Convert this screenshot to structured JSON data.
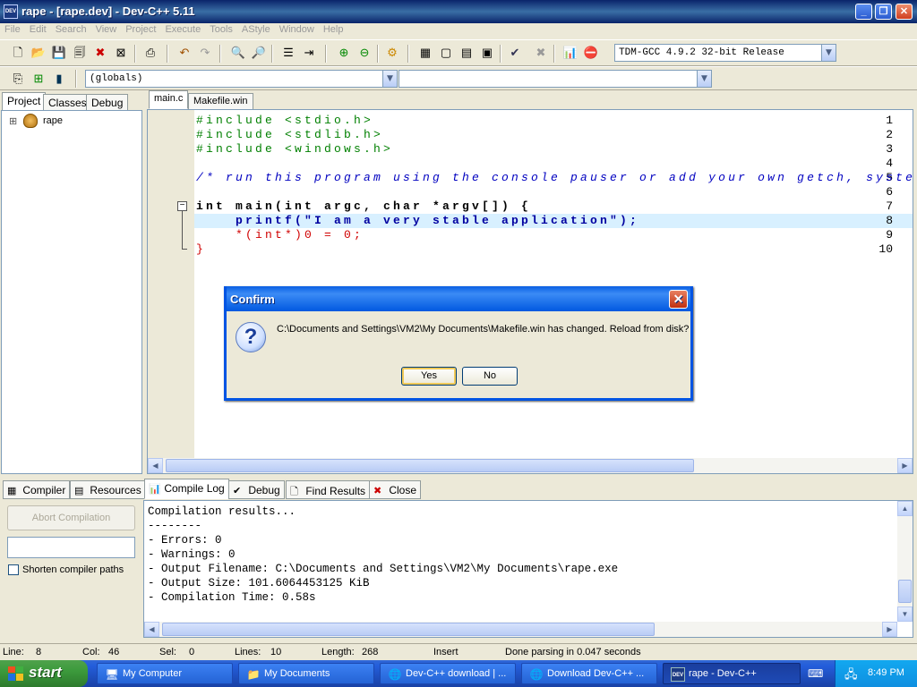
{
  "window": {
    "title": "rape - [rape.dev] - Dev-C++ 5.11",
    "app_icon": "DEV"
  },
  "menu": [
    "File",
    "Edit",
    "Search",
    "View",
    "Project",
    "Execute",
    "Tools",
    "AStyle",
    "Window",
    "Help"
  ],
  "toolbar": {
    "compiler_select": "TDM-GCC 4.9.2 32-bit Release",
    "scope_select": "(globals)",
    "symbol_select": ""
  },
  "left_panel": {
    "tabs": [
      "Project",
      "Classes",
      "Debug"
    ],
    "tree_root": "rape",
    "expander": "⊞"
  },
  "editor": {
    "tabs": [
      "main.c",
      "Makefile.win"
    ],
    "line_numbers": [
      "1",
      "2",
      "3",
      "4",
      "5",
      "6",
      "7",
      "8",
      "9",
      "10"
    ],
    "lines": [
      "#include <stdio.h>",
      "#include <stdlib.h>",
      "#include <windows.h>",
      "",
      "/* run this program using the console pauser or add your own getch, syste",
      "",
      "int main(int argc, char *argv[]) {",
      "    printf(\"I am a very stable application\");",
      "    *(int*)0 = 0;",
      "}"
    ],
    "current_line": 8
  },
  "bottom_panel": {
    "tabs": [
      "Compiler",
      "Resources",
      "Compile Log",
      "Debug",
      "Find Results",
      "Close"
    ],
    "abort_button": "Abort Compilation",
    "shorten_checkbox": "Shorten compiler paths",
    "log": [
      "Compilation results...",
      "--------",
      "- Errors: 0",
      "- Warnings: 0",
      "- Output Filename: C:\\Documents and Settings\\VM2\\My Documents\\rape.exe",
      "- Output Size: 101.6064453125 KiB",
      "- Compilation Time: 0.58s"
    ]
  },
  "status": {
    "line_label": "Line:",
    "line": "8",
    "col_label": "Col:",
    "col": "46",
    "sel_label": "Sel:",
    "sel": "0",
    "lines_label": "Lines:",
    "lines": "10",
    "length_label": "Length:",
    "length": "268",
    "mode": "Insert",
    "message": "Done parsing in 0.047 seconds"
  },
  "dialog": {
    "title": "Confirm",
    "message": "C:\\Documents and Settings\\VM2\\My Documents\\Makefile.win has changed. Reload from disk?",
    "yes": "Yes",
    "no": "No"
  },
  "taskbar": {
    "start": "start",
    "tasks": [
      "My Computer",
      "My Documents",
      "Dev-C++ download | ...",
      "Download Dev-C++ ...",
      "rape - Dev-C++"
    ],
    "clock": "8:49 PM"
  }
}
